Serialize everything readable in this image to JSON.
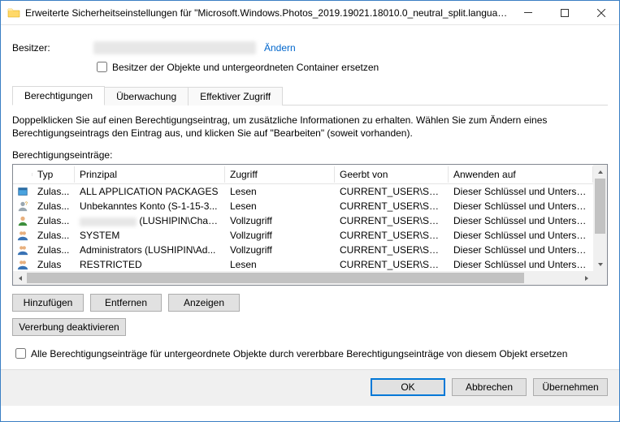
{
  "window": {
    "title": "Erweiterte Sicherheitseinstellungen für \"Microsoft.Windows.Photos_2019.19021.18010.0_neutral_split.language-..."
  },
  "owner": {
    "label": "Besitzer:",
    "change_link": "Ändern",
    "replace_checkbox": "Besitzer der Objekte und untergeordneten Container ersetzen"
  },
  "tabs": {
    "permissions": "Berechtigungen",
    "auditing": "Überwachung",
    "effective": "Effektiver Zugriff"
  },
  "help_text": "Doppelklicken Sie auf einen Berechtigungseintrag, um zusätzliche Informationen zu erhalten. Wählen Sie zum Ändern eines Berechtigungseintrags den Eintrag aus, und klicken Sie auf \"Bearbeiten\" (soweit vorhanden).",
  "list_label": "Berechtigungseinträge:",
  "columns": {
    "type": "Typ",
    "principal": "Prinzipal",
    "access": "Zugriff",
    "inherited": "Geerbt von",
    "applies": "Anwenden auf"
  },
  "rows": [
    {
      "icon": "package",
      "type": "Zulas...",
      "principal": "ALL APPLICATION PACKAGES",
      "access": "Lesen",
      "inherited": "CURRENT_USER\\Softw...",
      "applies": "Dieser Schlüssel und Unterschl"
    },
    {
      "icon": "unknown",
      "type": "Zulas...",
      "principal": "Unbekanntes Konto (S-1-15-3...",
      "access": "Lesen",
      "inherited": "CURRENT_USER\\Softw...",
      "applies": "Dieser Schlüssel und Unterschl"
    },
    {
      "icon": "user",
      "type": "Zulas...",
      "principal_prefix_blur": true,
      "principal": " (LUSHIPIN\\Chan...",
      "access": "Vollzugriff",
      "inherited": "CURRENT_USER\\Softw...",
      "applies": "Dieser Schlüssel und Unterschl"
    },
    {
      "icon": "group",
      "type": "Zulas...",
      "principal": "SYSTEM",
      "access": "Vollzugriff",
      "inherited": "CURRENT_USER\\Softw...",
      "applies": "Dieser Schlüssel und Unterschl"
    },
    {
      "icon": "group",
      "type": "Zulas...",
      "principal": "Administrators (LUSHIPIN\\Ad...",
      "access": "Vollzugriff",
      "inherited": "CURRENT_USER\\Softw...",
      "applies": "Dieser Schlüssel und Unterschl"
    },
    {
      "icon": "group",
      "type": "Zulas",
      "principal": "RESTRICTED",
      "access": "Lesen",
      "inherited": "CURRENT_USER\\Softw",
      "applies": "Dieser Schlüssel und Unterschl"
    }
  ],
  "buttons": {
    "add": "Hinzufügen",
    "remove": "Entfernen",
    "view": "Anzeigen",
    "disable_inherit": "Vererbung deaktivieren",
    "replace_all": "Alle Berechtigungseinträge für untergeordnete Objekte durch vererbbare Berechtigungseinträge von diesem Objekt ersetzen",
    "ok": "OK",
    "cancel": "Abbrechen",
    "apply": "Übernehmen"
  }
}
